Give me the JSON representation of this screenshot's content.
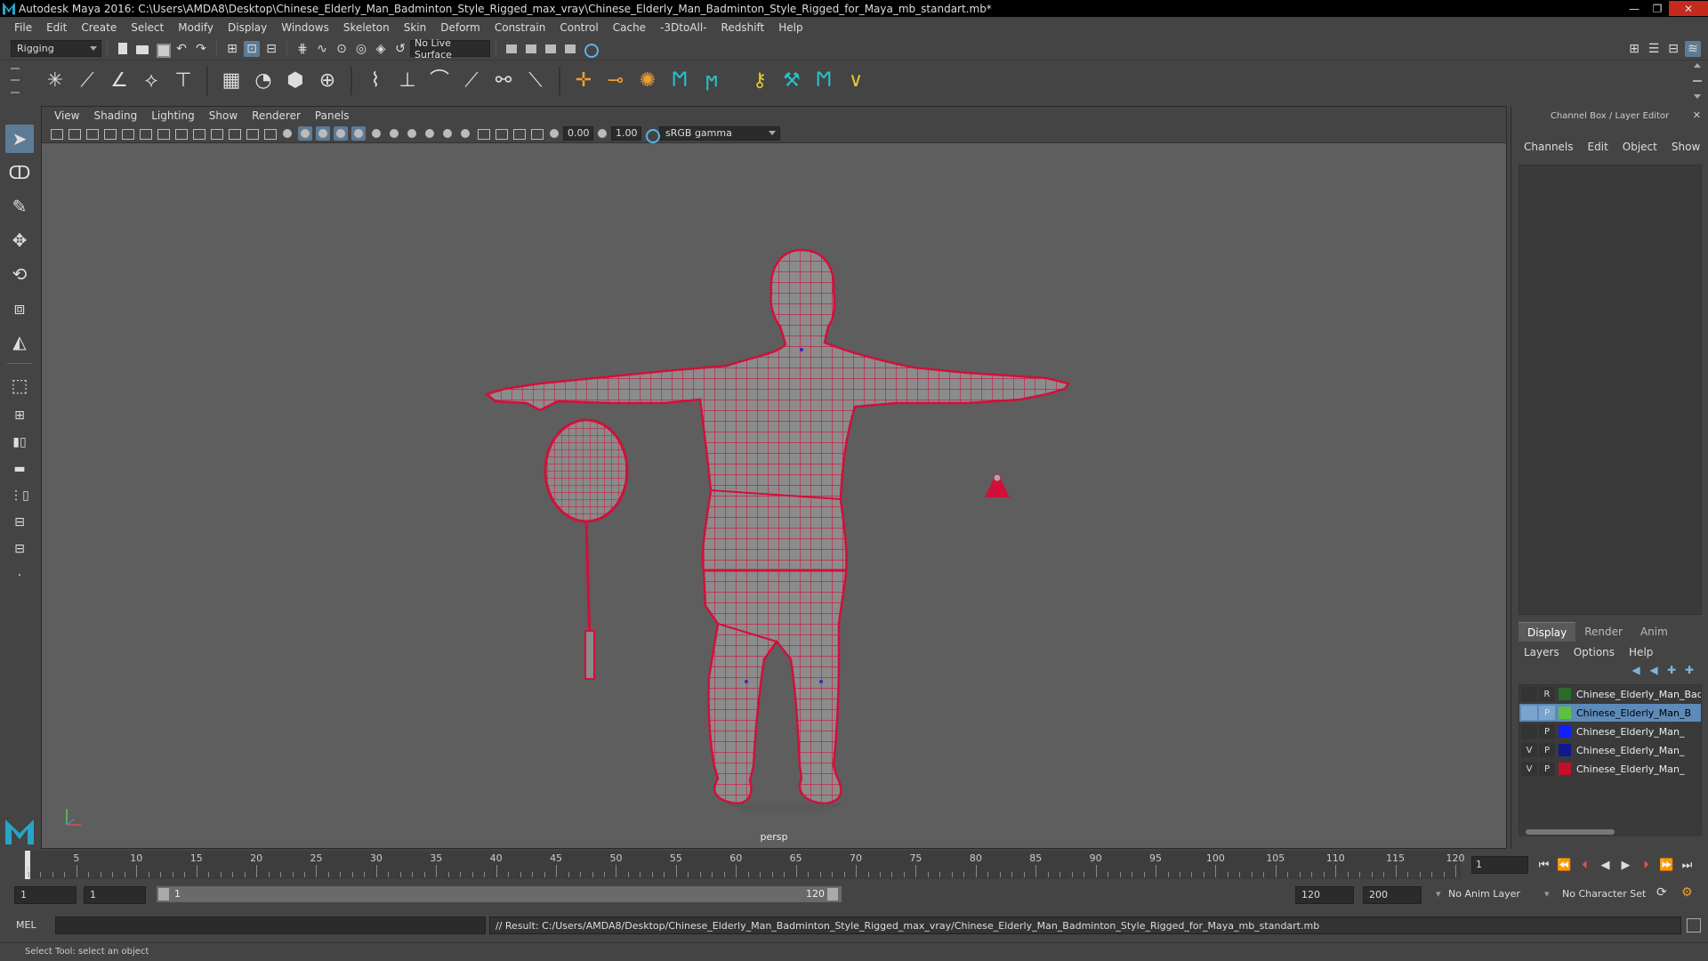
{
  "window": {
    "title": "Autodesk Maya 2016: C:\\Users\\AMDA8\\Desktop\\Chinese_Elderly_Man_Badminton_Style_Rigged_max_vray\\Chinese_Elderly_Man_Badminton_Style_Rigged_for_Maya_mb_standart.mb*",
    "min": "—",
    "max": "❐",
    "close": "✕"
  },
  "menubar": [
    "File",
    "Edit",
    "Create",
    "Select",
    "Modify",
    "Display",
    "Windows",
    "Skeleton",
    "Skin",
    "Deform",
    "Constrain",
    "Control",
    "Cache",
    "-3DtoAll-",
    "Redshift",
    "Help"
  ],
  "statusline": {
    "mode": "Rigging",
    "live_surface": "No Live Surface"
  },
  "viewport": {
    "menus": [
      "View",
      "Shading",
      "Lighting",
      "Show",
      "Renderer",
      "Panels"
    ],
    "exposure": "0.00",
    "gamma": "1.00",
    "color_space": "sRGB gamma",
    "camera_label": "persp"
  },
  "right_panel": {
    "title": "Channel Box / Layer Editor",
    "channel_tabs": [
      "Channels",
      "Edit",
      "Object",
      "Show"
    ],
    "layer_tabs": [
      "Display",
      "Render",
      "Anim"
    ],
    "layer_menu": [
      "Layers",
      "Options",
      "Help"
    ],
    "layers": [
      {
        "v": "",
        "p": "R",
        "color": "#2a6a2a",
        "name": "Chinese_Elderly_Man_Badminton",
        "selected": false
      },
      {
        "v": "",
        "p": "P",
        "color": "#5ec040",
        "name": "Chinese_Elderly_Man_B",
        "selected": true
      },
      {
        "v": "",
        "p": "P",
        "color": "#1020ff",
        "name": "Chinese_Elderly_Man_",
        "selected": false
      },
      {
        "v": "V",
        "p": "P",
        "color": "#101890",
        "name": "Chinese_Elderly_Man_",
        "selected": false
      },
      {
        "v": "V",
        "p": "P",
        "color": "#c0102a",
        "name": "Chinese_Elderly_Man_",
        "selected": false
      }
    ]
  },
  "timeline": {
    "start": 1,
    "end": 120,
    "current_frame": "1",
    "frame_field": "1",
    "ticks": [
      5,
      10,
      15,
      20,
      25,
      30,
      35,
      40,
      45,
      50,
      55,
      60,
      65,
      70,
      75,
      80,
      85,
      90,
      95,
      100,
      105,
      110,
      115,
      120
    ]
  },
  "range": {
    "start_field": "1",
    "start_inner": "1",
    "slider_start": "1",
    "slider_end": "120",
    "end_inner": "120",
    "end_field": "200",
    "anim_layer": "No Anim Layer",
    "char_set": "No Character Set"
  },
  "command": {
    "language": "MEL",
    "result": "// Result: C:/Users/AMDA8/Desktop/Chinese_Elderly_Man_Badminton_Style_Rigged_max_vray/Chinese_Elderly_Man_Badminton_Style_Rigged_for_Maya_mb_standart.mb"
  },
  "help_line": "Select Tool: select an object",
  "colors": {
    "wireframe": "#d0103a",
    "accent": "#5d7b95",
    "maya_teal": "#2aa3c8"
  }
}
